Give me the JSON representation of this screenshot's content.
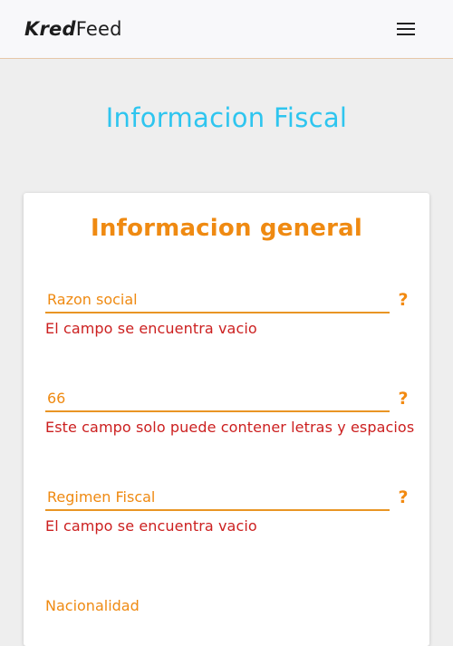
{
  "header": {
    "logo_bold": "Kred",
    "logo_light": "Feed",
    "menu_icon": "hamburger-menu-icon"
  },
  "page": {
    "title": "Informacion Fiscal"
  },
  "card": {
    "title": "Informacion general",
    "fields": [
      {
        "placeholder": "Razon social",
        "value": "",
        "error": "El campo se encuentra vacio",
        "help": "?"
      },
      {
        "placeholder": "",
        "value": "66",
        "error": "Este campo solo puede contener letras y espacios",
        "help": "?"
      },
      {
        "placeholder": "Regimen Fiscal",
        "value": "",
        "error": "El campo se encuentra vacio",
        "help": "?"
      }
    ],
    "nationality_label": "Nacionalidad"
  },
  "colors": {
    "accent": "#ef8a12",
    "title_blue": "#2ec5ef",
    "error_red": "#cc2020"
  }
}
